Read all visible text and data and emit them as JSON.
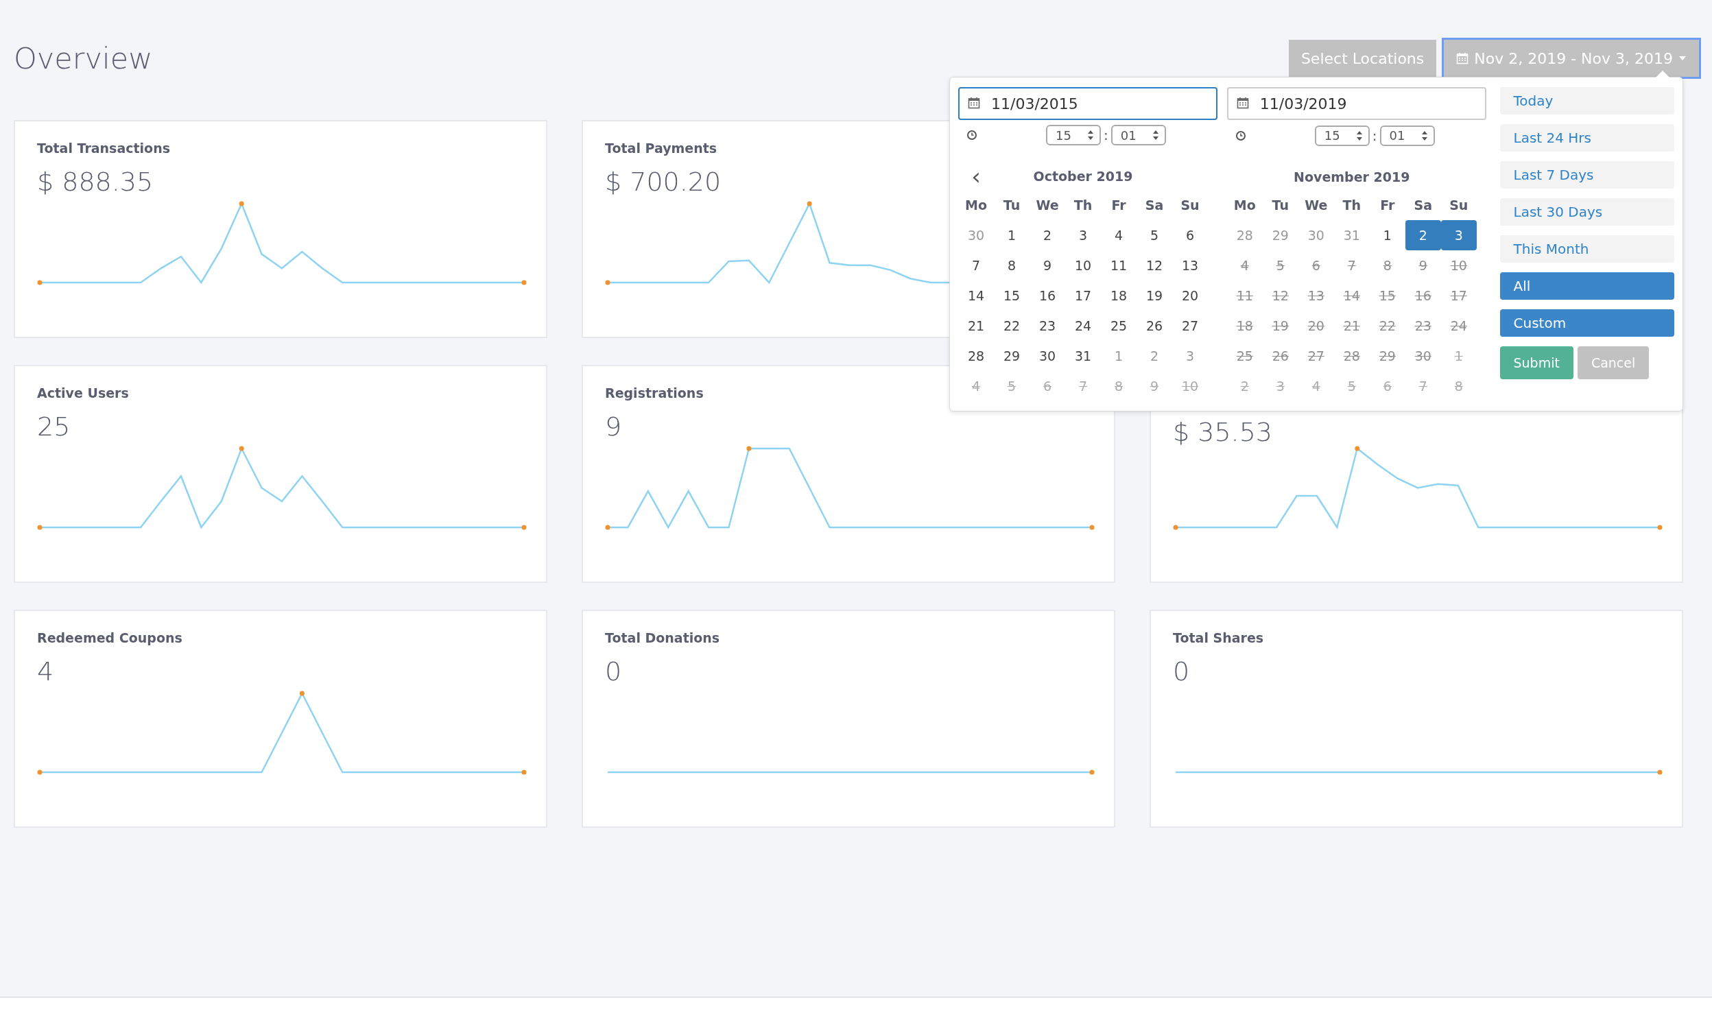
{
  "page": {
    "title": "Overview"
  },
  "header_buttons": {
    "locations": "Select Locations",
    "date_range": "Nov 2, 2019 - Nov 3, 2019"
  },
  "card_rows": [
    [
      {
        "label": "Total Transactions",
        "value": "$ 888.35"
      },
      {
        "label": "Total Payments",
        "value": "$ 700.20"
      }
    ],
    [
      {
        "label": "Active Users",
        "value": "25"
      },
      {
        "label": "Registrations",
        "value": "9"
      },
      {
        "value": "$ 35.53"
      }
    ],
    [
      {
        "label": "Redeemed Coupons",
        "value": "4"
      },
      {
        "label": "Total Donations",
        "value": "0"
      },
      {
        "label": "Total Shares",
        "value": "0"
      }
    ]
  ],
  "picker": {
    "inputs": [
      {
        "value": "11/03/2015",
        "focused": true,
        "hour": "15",
        "minute": "01",
        "separator": ":"
      },
      {
        "value": "11/03/2019",
        "focused": false,
        "hour": "15",
        "minute": "01",
        "separator": ":"
      }
    ],
    "prev_arrow": "‹",
    "months": [
      {
        "title": "October 2019",
        "weekdays": [
          "Mo",
          "Tu",
          "We",
          "Th",
          "Fr",
          "Sa",
          "Su"
        ],
        "weeks": [
          [
            {
              "d": "30",
              "outside": true,
              "disabled": false,
              "selected": false
            },
            {
              "d": "1",
              "outside": false,
              "disabled": false,
              "selected": false
            },
            {
              "d": "2",
              "outside": false,
              "disabled": false,
              "selected": false
            },
            {
              "d": "3",
              "outside": false,
              "disabled": false,
              "selected": false
            },
            {
              "d": "4",
              "outside": false,
              "disabled": false,
              "selected": false
            },
            {
              "d": "5",
              "outside": false,
              "disabled": false,
              "selected": false
            },
            {
              "d": "6",
              "outside": false,
              "disabled": false,
              "selected": false
            }
          ],
          [
            {
              "d": "7",
              "outside": false,
              "disabled": false,
              "selected": false
            },
            {
              "d": "8",
              "outside": false,
              "disabled": false,
              "selected": false
            },
            {
              "d": "9",
              "outside": false,
              "disabled": false,
              "selected": false
            },
            {
              "d": "10",
              "outside": false,
              "disabled": false,
              "selected": false
            },
            {
              "d": "11",
              "outside": false,
              "disabled": false,
              "selected": false
            },
            {
              "d": "12",
              "outside": false,
              "disabled": false,
              "selected": false
            },
            {
              "d": "13",
              "outside": false,
              "disabled": false,
              "selected": false
            }
          ],
          [
            {
              "d": "14",
              "outside": false,
              "disabled": false,
              "selected": false
            },
            {
              "d": "15",
              "outside": false,
              "disabled": false,
              "selected": false
            },
            {
              "d": "16",
              "outside": false,
              "disabled": false,
              "selected": false
            },
            {
              "d": "17",
              "outside": false,
              "disabled": false,
              "selected": false
            },
            {
              "d": "18",
              "outside": false,
              "disabled": false,
              "selected": false
            },
            {
              "d": "19",
              "outside": false,
              "disabled": false,
              "selected": false
            },
            {
              "d": "20",
              "outside": false,
              "disabled": false,
              "selected": false
            }
          ],
          [
            {
              "d": "21",
              "outside": false,
              "disabled": false,
              "selected": false
            },
            {
              "d": "22",
              "outside": false,
              "disabled": false,
              "selected": false
            },
            {
              "d": "23",
              "outside": false,
              "disabled": false,
              "selected": false
            },
            {
              "d": "24",
              "outside": false,
              "disabled": false,
              "selected": false
            },
            {
              "d": "25",
              "outside": false,
              "disabled": false,
              "selected": false
            },
            {
              "d": "26",
              "outside": false,
              "disabled": false,
              "selected": false
            },
            {
              "d": "27",
              "outside": false,
              "disabled": false,
              "selected": false
            }
          ],
          [
            {
              "d": "28",
              "outside": false,
              "disabled": false,
              "selected": false
            },
            {
              "d": "29",
              "outside": false,
              "disabled": false,
              "selected": false
            },
            {
              "d": "30",
              "outside": false,
              "disabled": false,
              "selected": false
            },
            {
              "d": "31",
              "outside": false,
              "disabled": false,
              "selected": false
            },
            {
              "d": "1",
              "outside": true,
              "disabled": false,
              "selected": false
            },
            {
              "d": "2",
              "outside": true,
              "disabled": false,
              "selected": false
            },
            {
              "d": "3",
              "outside": true,
              "disabled": false,
              "selected": false
            }
          ],
          [
            {
              "d": "4",
              "outside": true,
              "disabled": true,
              "selected": false
            },
            {
              "d": "5",
              "outside": true,
              "disabled": true,
              "selected": false
            },
            {
              "d": "6",
              "outside": true,
              "disabled": true,
              "selected": false
            },
            {
              "d": "7",
              "outside": true,
              "disabled": true,
              "selected": false
            },
            {
              "d": "8",
              "outside": true,
              "disabled": true,
              "selected": false
            },
            {
              "d": "9",
              "outside": true,
              "disabled": true,
              "selected": false
            },
            {
              "d": "10",
              "outside": true,
              "disabled": true,
              "selected": false
            }
          ]
        ]
      },
      {
        "title": "November 2019",
        "weekdays": [
          "Mo",
          "Tu",
          "We",
          "Th",
          "Fr",
          "Sa",
          "Su"
        ],
        "weeks": [
          [
            {
              "d": "28",
              "outside": true,
              "disabled": false,
              "selected": false
            },
            {
              "d": "29",
              "outside": true,
              "disabled": false,
              "selected": false
            },
            {
              "d": "30",
              "outside": true,
              "disabled": false,
              "selected": false
            },
            {
              "d": "31",
              "outside": true,
              "disabled": false,
              "selected": false
            },
            {
              "d": "1",
              "outside": false,
              "disabled": false,
              "selected": false
            },
            {
              "d": "2",
              "outside": false,
              "disabled": false,
              "selected": true
            },
            {
              "d": "3",
              "outside": false,
              "disabled": false,
              "selected": true
            }
          ],
          [
            {
              "d": "4",
              "outside": false,
              "disabled": true,
              "selected": false
            },
            {
              "d": "5",
              "outside": false,
              "disabled": true,
              "selected": false
            },
            {
              "d": "6",
              "outside": false,
              "disabled": true,
              "selected": false
            },
            {
              "d": "7",
              "outside": false,
              "disabled": true,
              "selected": false
            },
            {
              "d": "8",
              "outside": false,
              "disabled": true,
              "selected": false
            },
            {
              "d": "9",
              "outside": false,
              "disabled": true,
              "selected": false
            },
            {
              "d": "10",
              "outside": false,
              "disabled": true,
              "selected": false
            }
          ],
          [
            {
              "d": "11",
              "outside": false,
              "disabled": true,
              "selected": false
            },
            {
              "d": "12",
              "outside": false,
              "disabled": true,
              "selected": false
            },
            {
              "d": "13",
              "outside": false,
              "disabled": true,
              "selected": false
            },
            {
              "d": "14",
              "outside": false,
              "disabled": true,
              "selected": false
            },
            {
              "d": "15",
              "outside": false,
              "disabled": true,
              "selected": false
            },
            {
              "d": "16",
              "outside": false,
              "disabled": true,
              "selected": false
            },
            {
              "d": "17",
              "outside": false,
              "disabled": true,
              "selected": false
            }
          ],
          [
            {
              "d": "18",
              "outside": false,
              "disabled": true,
              "selected": false
            },
            {
              "d": "19",
              "outside": false,
              "disabled": true,
              "selected": false
            },
            {
              "d": "20",
              "outside": false,
              "disabled": true,
              "selected": false
            },
            {
              "d": "21",
              "outside": false,
              "disabled": true,
              "selected": false
            },
            {
              "d": "22",
              "outside": false,
              "disabled": true,
              "selected": false
            },
            {
              "d": "23",
              "outside": false,
              "disabled": true,
              "selected": false
            },
            {
              "d": "24",
              "outside": false,
              "disabled": true,
              "selected": false
            }
          ],
          [
            {
              "d": "25",
              "outside": false,
              "disabled": true,
              "selected": false
            },
            {
              "d": "26",
              "outside": false,
              "disabled": true,
              "selected": false
            },
            {
              "d": "27",
              "outside": false,
              "disabled": true,
              "selected": false
            },
            {
              "d": "28",
              "outside": false,
              "disabled": true,
              "selected": false
            },
            {
              "d": "29",
              "outside": false,
              "disabled": true,
              "selected": false
            },
            {
              "d": "30",
              "outside": false,
              "disabled": true,
              "selected": false
            },
            {
              "d": "1",
              "outside": true,
              "disabled": true,
              "selected": false
            }
          ],
          [
            {
              "d": "2",
              "outside": true,
              "disabled": true,
              "selected": false
            },
            {
              "d": "3",
              "outside": true,
              "disabled": true,
              "selected": false
            },
            {
              "d": "4",
              "outside": true,
              "disabled": true,
              "selected": false
            },
            {
              "d": "5",
              "outside": true,
              "disabled": true,
              "selected": false
            },
            {
              "d": "6",
              "outside": true,
              "disabled": true,
              "selected": false
            },
            {
              "d": "7",
              "outside": true,
              "disabled": true,
              "selected": false
            },
            {
              "d": "8",
              "outside": true,
              "disabled": true,
              "selected": false
            }
          ]
        ]
      }
    ],
    "ranges": [
      {
        "label": "Today",
        "selected": false
      },
      {
        "label": "Last 24 Hrs",
        "selected": false
      },
      {
        "label": "Last 7 Days",
        "selected": false
      },
      {
        "label": "Last 30 Days",
        "selected": false
      },
      {
        "label": "This Month",
        "selected": false
      },
      {
        "label": "All",
        "selected": true
      },
      {
        "label": "Custom",
        "selected": true
      }
    ],
    "submit": "Submit",
    "cancel": "Cancel"
  }
}
